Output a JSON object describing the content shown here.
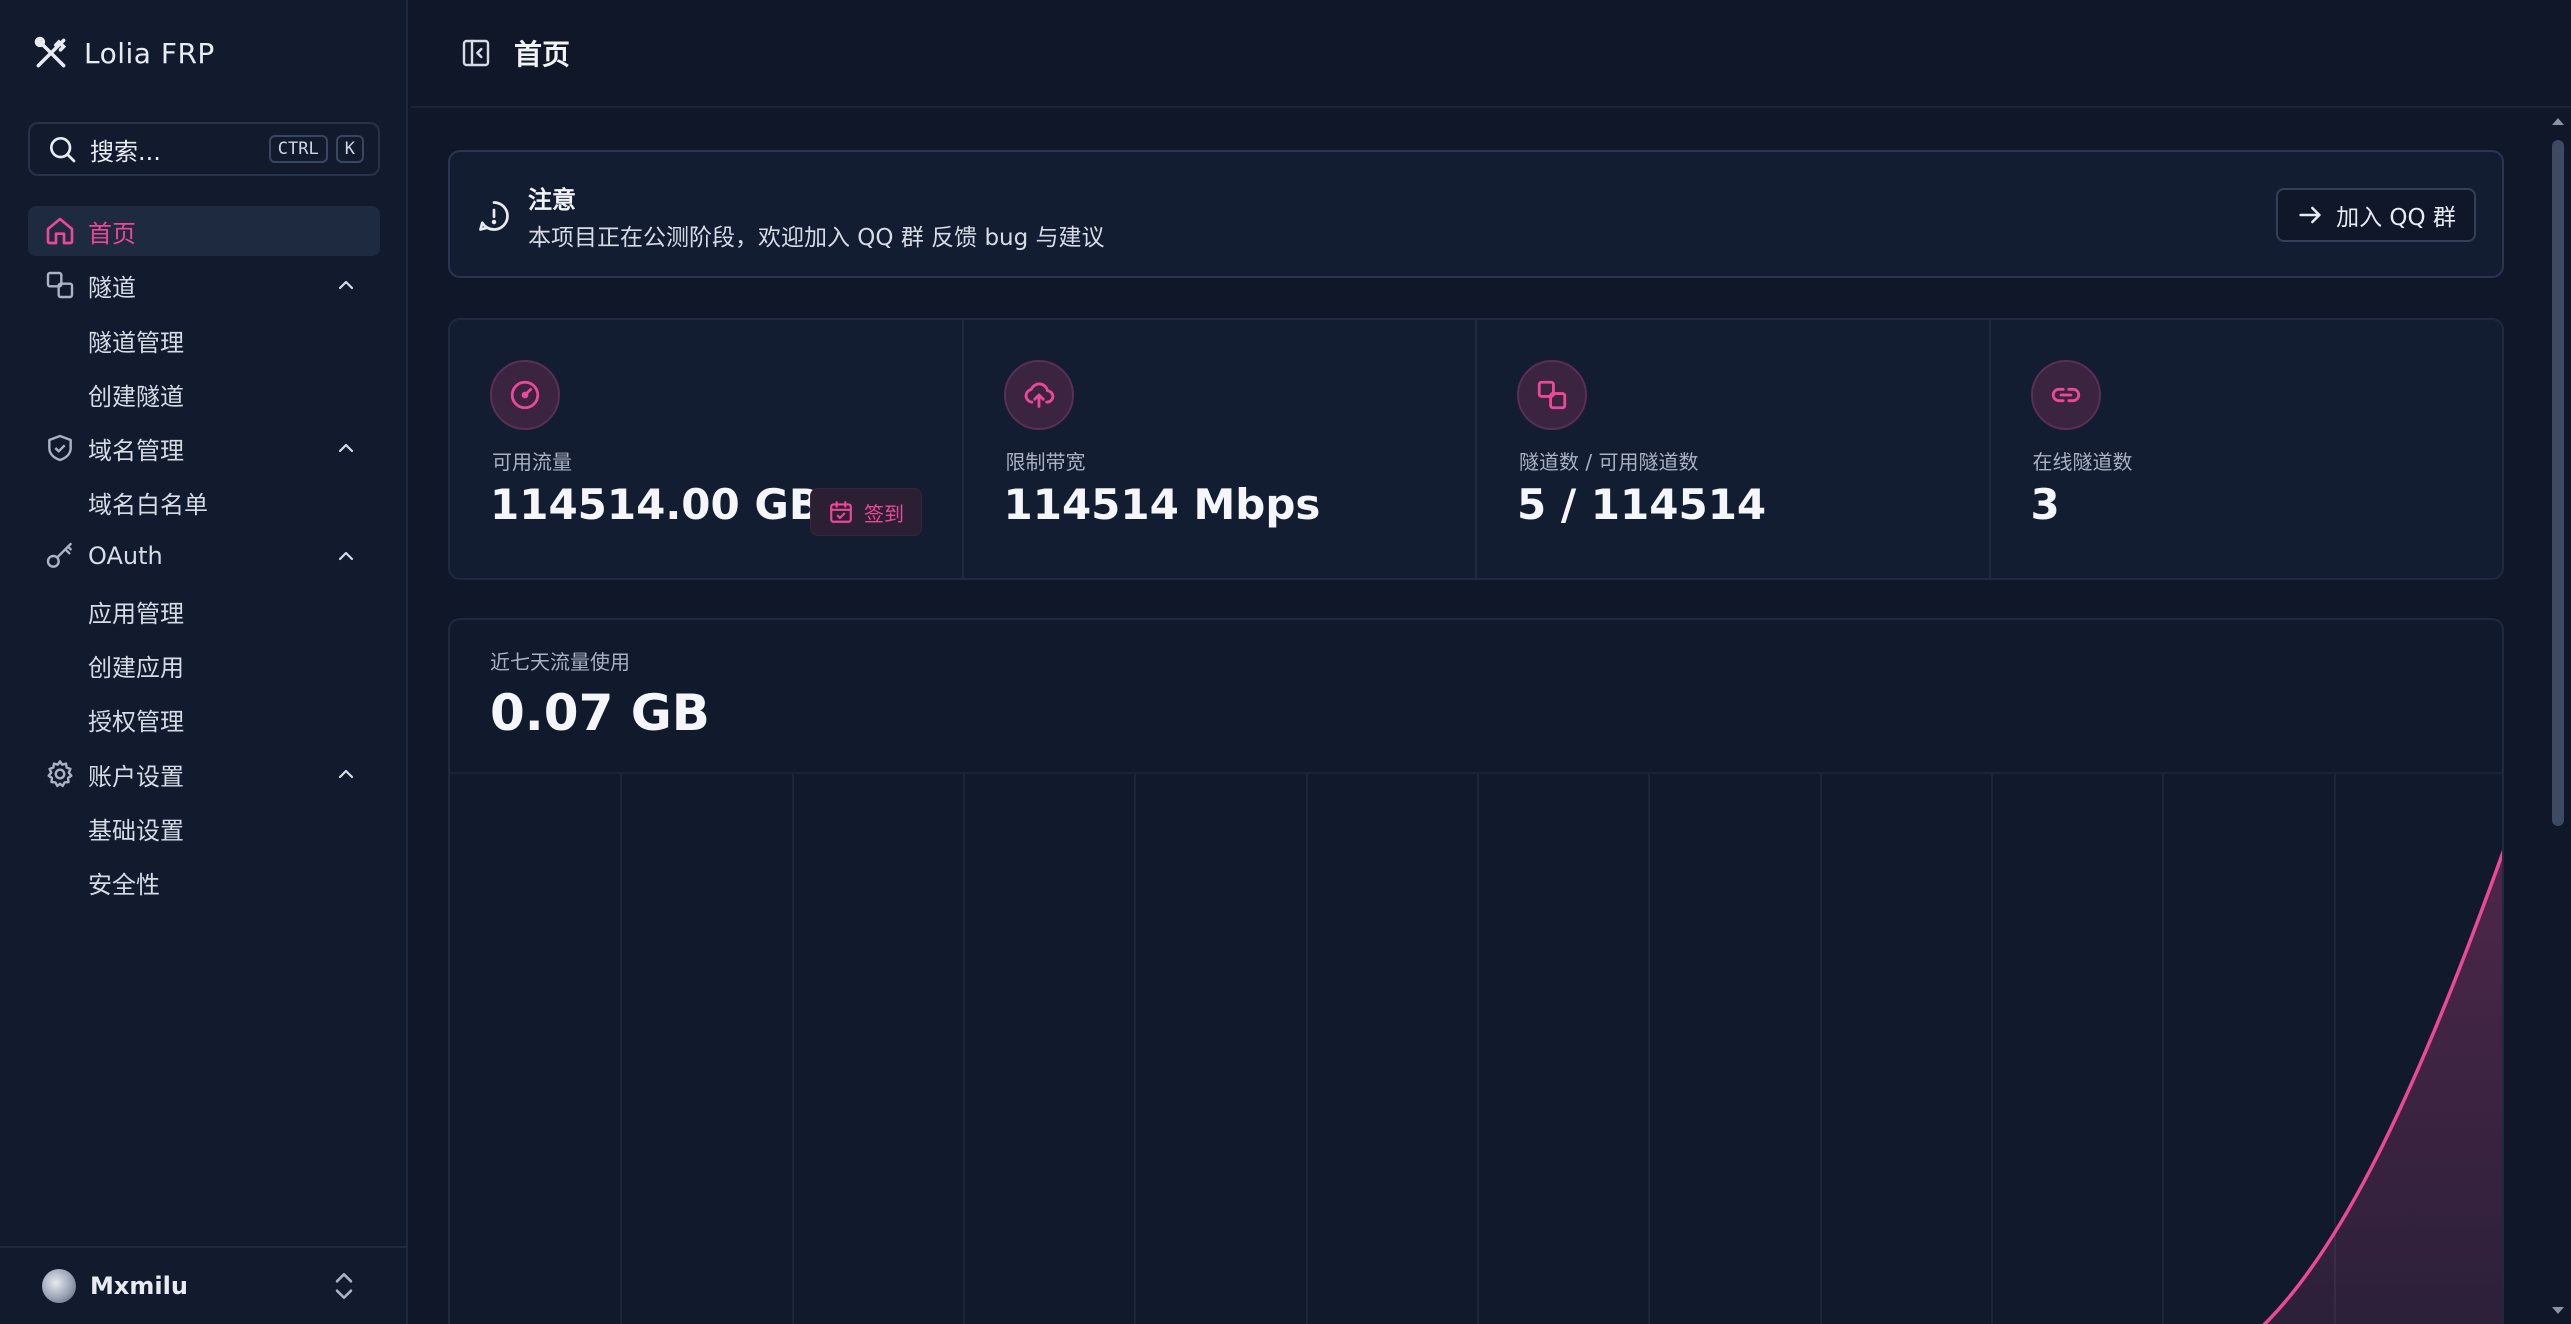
{
  "app": {
    "name": "Lolia FRP"
  },
  "search": {
    "placeholder": "搜索...",
    "shortcut_ctrl": "CTRL",
    "shortcut_key": "K"
  },
  "sidebar": {
    "home": "首页",
    "tunnels": {
      "label": "隧道",
      "items": [
        "隧道管理",
        "创建隧道"
      ]
    },
    "domains": {
      "label": "域名管理",
      "items": [
        "域名白名单"
      ]
    },
    "oauth": {
      "label": "OAuth",
      "items": [
        "应用管理",
        "创建应用",
        "授权管理"
      ]
    },
    "account": {
      "label": "账户设置",
      "items": [
        "基础设置",
        "安全性"
      ]
    },
    "user": {
      "name": "Mxmilu"
    }
  },
  "header": {
    "title": "首页"
  },
  "notice": {
    "title": "注意",
    "text": "本项目正在公测阶段，欢迎加入 QQ 群 反馈 bug 与建议",
    "button": "加入 QQ 群"
  },
  "stats": {
    "traffic": {
      "label": "可用流量",
      "value": "114514.00 GB",
      "checkin": "签到"
    },
    "bandwidth": {
      "label": "限制带宽",
      "value": "114514 Mbps"
    },
    "tunnels": {
      "label": "隧道数 / 可用隧道数",
      "value": "5 / 114514"
    },
    "online": {
      "label": "在线隧道数",
      "value": "3"
    }
  },
  "usage": {
    "label": "近七天流量使用",
    "value": "0.07 GB"
  },
  "colors": {
    "accent": "#ec4899",
    "background": "#0f1729",
    "sidebar": "#121b2e"
  }
}
